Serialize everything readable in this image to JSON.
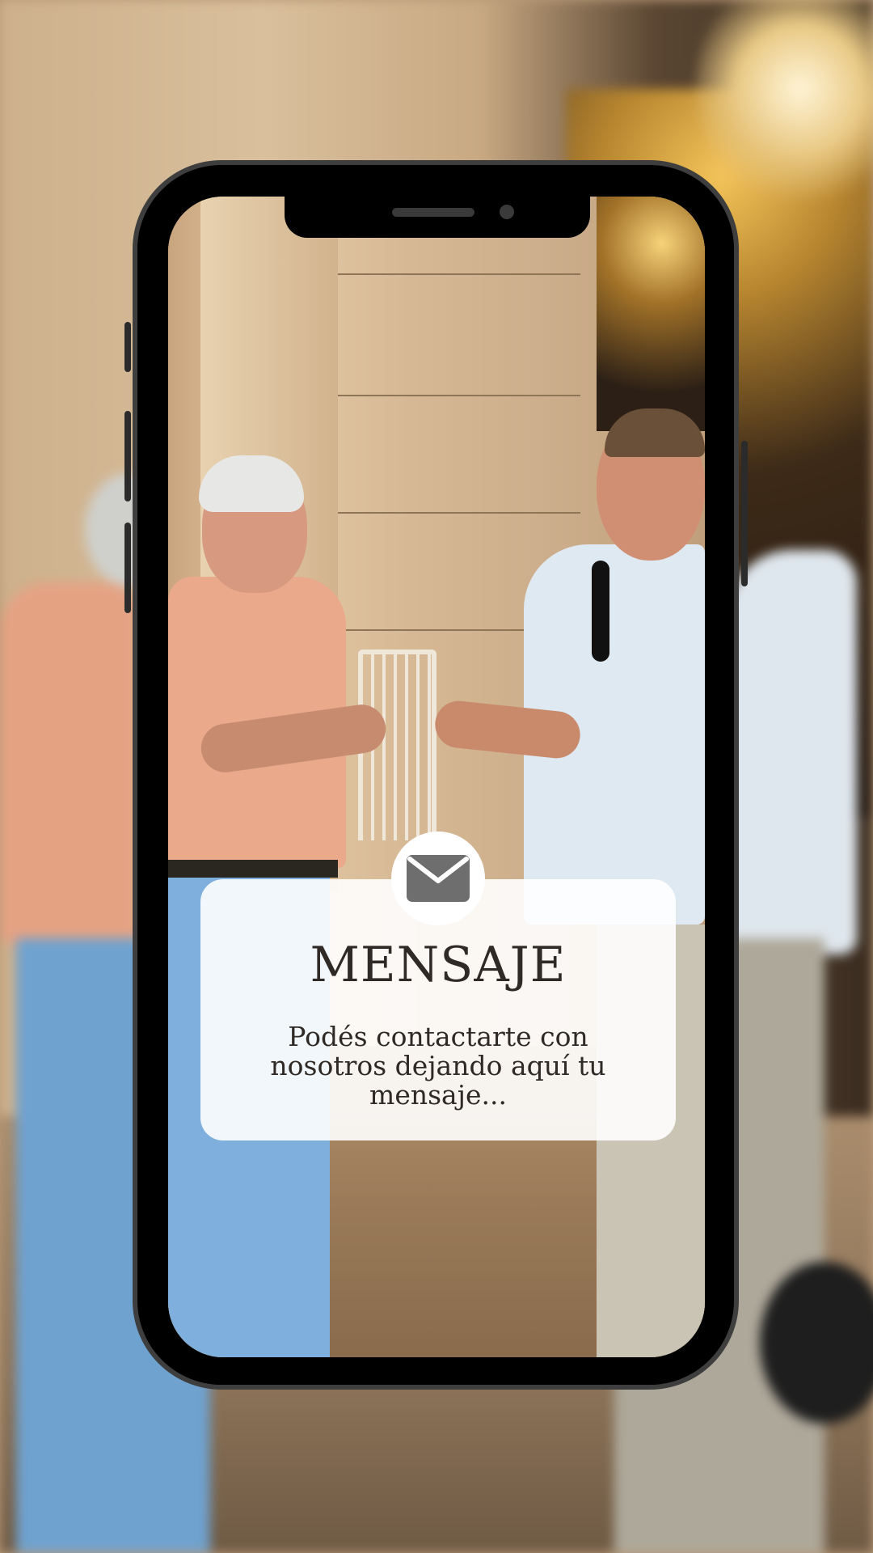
{
  "card": {
    "icon": "envelope-icon",
    "title": "MENSAJE",
    "body": "Podés contactarte con nosotros dejando aquí tu mensaje..."
  },
  "colors": {
    "card_background": "#ffffff",
    "icon_color": "#6e6e6e",
    "text_color": "#2f2a26",
    "phone_frame": "#000000"
  }
}
